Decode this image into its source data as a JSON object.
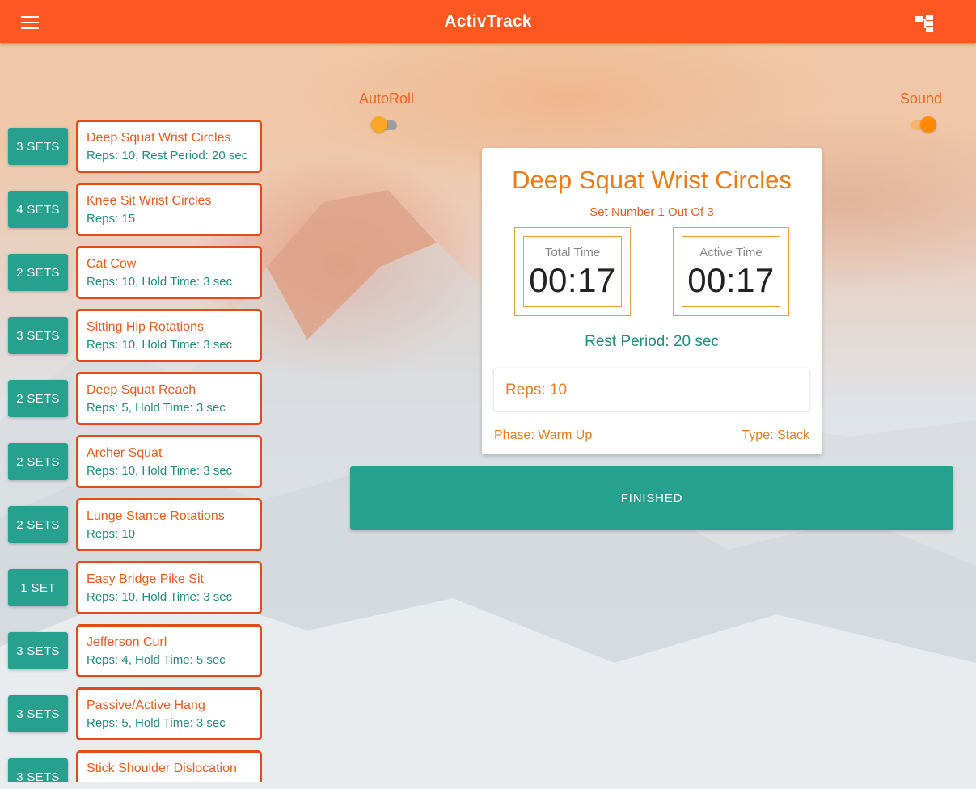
{
  "app": {
    "title": "ActivTrack",
    "menu_icon": "menu-icon",
    "tree_icon": "tree-structure-icon"
  },
  "colors": {
    "app_bar": "#ff5722",
    "teal": "#26a08f",
    "accent_orange": "#f07a16",
    "card_border": "#e64a19"
  },
  "toggles": {
    "autoroll": {
      "label": "AutoRoll",
      "on": false
    },
    "sound": {
      "label": "Sound",
      "on": true
    }
  },
  "exercises": [
    {
      "sets": "3 SETS",
      "name": "Deep Squat Wrist Circles",
      "detail": "Reps: 10, Rest Period: 20 sec"
    },
    {
      "sets": "4 SETS",
      "name": "Knee Sit Wrist Circles",
      "detail": "Reps: 15"
    },
    {
      "sets": "2 SETS",
      "name": "Cat Cow",
      "detail": "Reps: 10, Hold Time: 3 sec"
    },
    {
      "sets": "3 SETS",
      "name": "Sitting Hip Rotations",
      "detail": "Reps: 10, Hold Time: 3 sec"
    },
    {
      "sets": "2 SETS",
      "name": "Deep Squat Reach",
      "detail": "Reps: 5, Hold Time: 3 sec"
    },
    {
      "sets": "2 SETS",
      "name": "Archer Squat",
      "detail": "Reps: 10, Hold Time: 3 sec"
    },
    {
      "sets": "2 SETS",
      "name": "Lunge Stance Rotations",
      "detail": "Reps: 10"
    },
    {
      "sets": "1 SET",
      "name": "Easy Bridge Pike Sit",
      "detail": "Reps: 10, Hold Time: 3 sec"
    },
    {
      "sets": "3 SETS",
      "name": "Jefferson Curl",
      "detail": "Reps: 4, Hold Time: 5 sec"
    },
    {
      "sets": "3 SETS",
      "name": "Passive/Active Hang",
      "detail": "Reps: 5, Hold Time: 3 sec"
    },
    {
      "sets": "3 SETS",
      "name": "Stick Shoulder Dislocation",
      "detail": ""
    }
  ],
  "current": {
    "title": "Deep Squat Wrist Circles",
    "set_number": "Set Number 1 Out Of 3",
    "total_time_label": "Total Time",
    "total_time": "00:17",
    "active_time_label": "Active Time",
    "active_time": "00:17",
    "rest_period": "Rest Period: 20 sec",
    "reps": "Reps: 10",
    "phase": "Phase: Warm Up",
    "type": "Type: Stack"
  },
  "finished_label": "FINISHED"
}
